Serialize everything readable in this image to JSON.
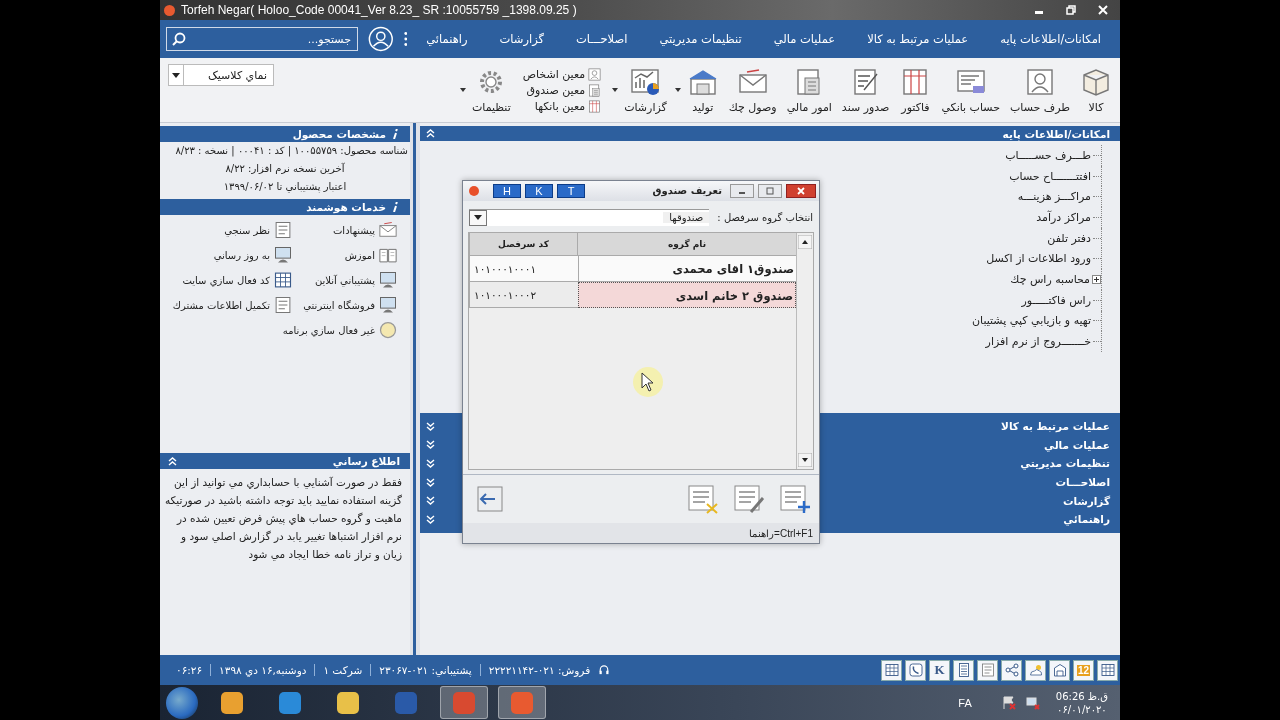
{
  "window": {
    "title": "Torfeh Negar( Holoo_Code 00041_Ver 8.23_ SR :10055759 _1398.09.25 )"
  },
  "menu_bar": {
    "items": [
      "امکانات/اطلاعات پايه",
      "عمليات مرتبط به کالا",
      "عمليات مالي",
      "تنظيمات مديريتي",
      "اصلاحـــات",
      "گزارشات",
      "راهنمائي"
    ],
    "search": {
      "placeholder": "جستجو..."
    }
  },
  "toolbar": {
    "items": [
      {
        "kind": "large",
        "label": "کالا",
        "dropdown": false
      },
      {
        "kind": "large",
        "label": "طرف حساب",
        "dropdown": false
      },
      {
        "kind": "large",
        "label": "حساب بانکي",
        "dropdown": false
      },
      {
        "kind": "large",
        "label": "فاکتور",
        "dropdown": false
      },
      {
        "kind": "large",
        "label": "صدور سند",
        "dropdown": false
      },
      {
        "kind": "large",
        "label": "امور مالي",
        "dropdown": false
      },
      {
        "kind": "large",
        "label": "وصول چك",
        "dropdown": false
      },
      {
        "kind": "large",
        "label": "توليد",
        "dropdown": true
      },
      {
        "kind": "large",
        "label": "گزارشات",
        "dropdown": true
      },
      {
        "kind": "stack",
        "items": [
          "معين اشخاص",
          "معين صندوق",
          "معين بانکها"
        ]
      },
      {
        "kind": "large",
        "label": "تنظيمات",
        "dropdown": true
      }
    ],
    "view_select": "نماي کلاسيک"
  },
  "product_info": {
    "title": "مشخصات محصول",
    "lines": [
      "شناسه محصول: ۱۰۰۵۵۷۵۹ | کد : ۰۰۰۴۱ | نسخه : ۸/۲۳",
      "آخرين نسخه نرم افزار: ۸/۲۲",
      "اعتبار پشتيباني تا ۱۳۹۹/۰۶/۰۲"
    ]
  },
  "smart_services": {
    "title": "خدمات هوشمند",
    "items": [
      "پيشنهادات",
      "نظر سنجي",
      "اموزش",
      "به روز رساني",
      "پشتيباني آنلاين",
      "کد فعال سازي سايت",
      "فروشگاه اينترنتي",
      "تکميل اطلاعات مشترك",
      "غير فعال سازي برنامه"
    ]
  },
  "notification": {
    "title": "اطلاع رساني",
    "text": "فقط در صورت آشنايي با حسابداري مي توانيد از اين گزينه استفاده نماييد بايد توجه داشته باشيد در صورتيکه ماهيت و گروه حساب هاي پيش فرض تعيين شده در نرم افزار اشتباها تغيير يابد در گزارش اصلي سود و زيان و تراز نامه خطا ايجاد مي شود"
  },
  "base_info": {
    "title": "امکانات/اطلاعات پايه",
    "items": [
      {
        "kind": "leaf",
        "label": "طـــرف حســـــاب"
      },
      {
        "kind": "leaf",
        "label": "افتتـــــــاح حساب"
      },
      {
        "kind": "leaf",
        "label": "مراكـــز هزينـــه"
      },
      {
        "kind": "leaf",
        "label": "مراكز درآمد"
      },
      {
        "kind": "leaf",
        "label": "دفتر تلفن"
      },
      {
        "kind": "leaf",
        "label": "ورود اطلاعات از اكسل"
      },
      {
        "kind": "group",
        "label": "محاسبه راس چك",
        "expanded": false
      },
      {
        "kind": "leaf",
        "label": "راس فاكتـــــور"
      },
      {
        "kind": "leaf",
        "label": "تهيه و بازيابي كپي پشتيبان"
      },
      {
        "kind": "leaf",
        "label": "خـــــــروج از نرم افزار"
      }
    ]
  },
  "sections": [
    "عمليات مرتبط به کالا",
    "عمليات مالي",
    "تنظيمات مديريتي",
    "اصلاحـــات",
    "گزارشات",
    "راهنمائي"
  ],
  "dialog": {
    "title": "تعريف صندوق",
    "tabs": [
      "T",
      "K",
      "H"
    ],
    "group_label": "انتخاب گروه سرفصل :",
    "group_value": "صندوقها",
    "columns": [
      "نام گروه",
      "کد سرفصل"
    ],
    "rows": [
      {
        "name": "صندوق۱ اقای محمدی",
        "code": "۱۰۱۰۰۰۱۰۰۰۱",
        "selected": false
      },
      {
        "name": "صندوق ۲ خانم اسدی",
        "code": "۱۰۱۰۰۰۱۰۰۰۲",
        "selected": true
      }
    ],
    "hint": "Ctrl+F1=راهنما"
  },
  "status_bar": {
    "tools": [
      {
        "kind": "table"
      },
      {
        "kind": "date",
        "label": "12"
      },
      {
        "kind": "building"
      },
      {
        "kind": "weather"
      },
      {
        "kind": "share"
      },
      {
        "kind": "list"
      },
      {
        "kind": "calculator"
      },
      {
        "kind": "letter",
        "label": "K"
      },
      {
        "kind": "phone"
      },
      {
        "kind": "calendar"
      }
    ],
    "texts": [
      "فروش: ۰۲۱-۲۲۲۲۱۱۴۲",
      "پشتيباني: ۰۲۱-۲۳۰۶۷",
      "شرکت ۱",
      "دوشنبه,۱۶ دي ۱۳۹۸",
      "۰۶:۲۶"
    ]
  },
  "taskbar": {
    "apps": [
      {
        "kind": "media",
        "selected": false
      },
      {
        "kind": "browser",
        "selected": false
      },
      {
        "kind": "folder",
        "selected": false
      },
      {
        "kind": "word",
        "selected": false
      },
      {
        "kind": "chrome",
        "selected": true
      },
      {
        "kind": "app",
        "selected": true
      }
    ],
    "language": "FA",
    "time": "ق.ظ 06:26",
    "date": "۰۶/۰۱/۲۰۲۰"
  }
}
